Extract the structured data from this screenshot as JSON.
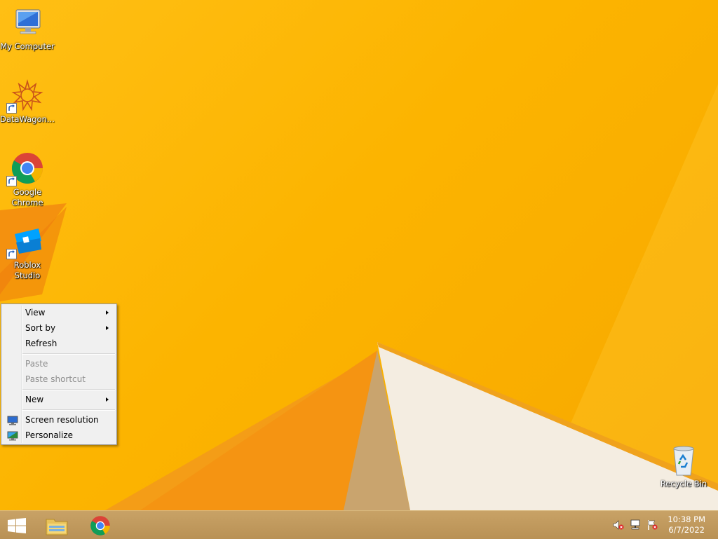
{
  "desktop": {
    "icons": [
      {
        "label": "My Computer",
        "icon": "computer-icon"
      },
      {
        "label": "DataWagon...",
        "icon": "datawagon-icon"
      },
      {
        "label": "Google Chrome",
        "icon": "chrome-icon"
      },
      {
        "label": "Roblox Studio",
        "icon": "roblox-studio-icon"
      },
      {
        "label": "Recycle Bin",
        "icon": "recycle-bin-icon"
      }
    ]
  },
  "context_menu": {
    "items": [
      {
        "label": "View",
        "submenu": true,
        "enabled": true
      },
      {
        "label": "Sort by",
        "submenu": true,
        "enabled": true
      },
      {
        "label": "Refresh",
        "submenu": false,
        "enabled": true
      },
      {
        "label": "Paste",
        "submenu": false,
        "enabled": false
      },
      {
        "label": "Paste shortcut",
        "submenu": false,
        "enabled": false
      },
      {
        "label": "New",
        "submenu": true,
        "enabled": true
      },
      {
        "label": "Screen resolution",
        "submenu": false,
        "enabled": true,
        "icon": "display-icon"
      },
      {
        "label": "Personalize",
        "submenu": false,
        "enabled": true,
        "icon": "personalize-icon"
      }
    ]
  },
  "taskbar": {
    "pinned": [
      {
        "name": "Start",
        "icon": "windows-logo-icon"
      },
      {
        "name": "File Explorer",
        "icon": "folder-icon"
      },
      {
        "name": "Google Chrome",
        "icon": "chrome-icon"
      }
    ],
    "tray": [
      "speaker-muted-icon",
      "network-icon",
      "action-center-flag-icon"
    ],
    "clock": {
      "time": "10:38 PM",
      "date": "6/7/2022"
    }
  },
  "colors": {
    "wallpaper": "#fcb400",
    "taskbar": "#bd9658"
  }
}
